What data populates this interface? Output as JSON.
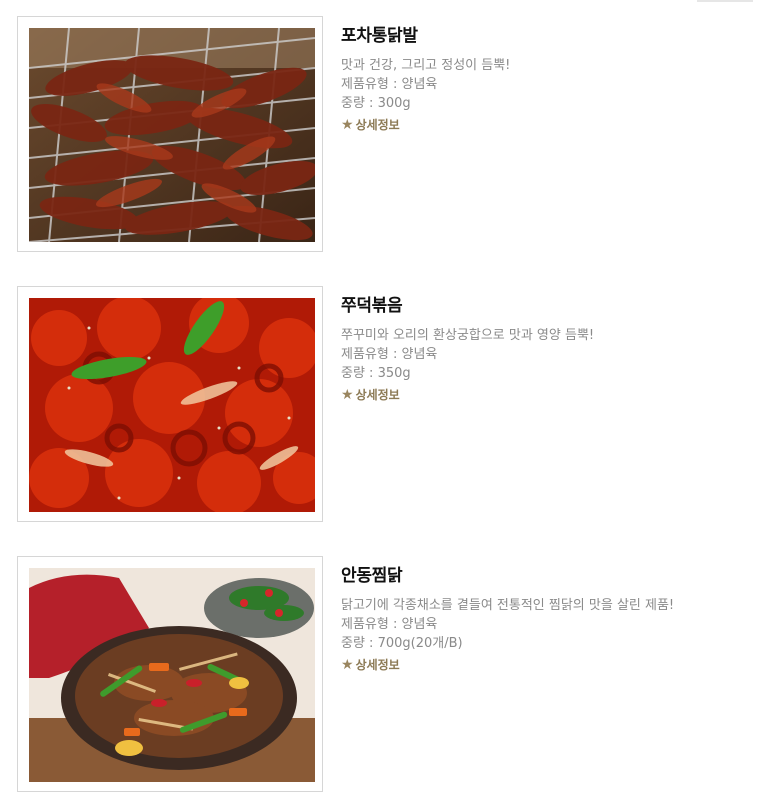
{
  "products": [
    {
      "name": "포차통닭발",
      "tagline": "맛과 건강, 그리고 정성이 듬뿍!",
      "type": "제품유형 : 양념육",
      "weight": "중량 : 300g",
      "detail_label": "상세정보",
      "image": "grilled-chicken-feet-photo"
    },
    {
      "name": "쭈덕볶음",
      "tagline": "쭈꾸미와 오리의 환상궁합으로 맛과 영양 듬뿍!",
      "type": "제품유형 : 양념육",
      "weight": "중량 : 350g",
      "detail_label": "상세정보",
      "image": "spicy-webfoot-octopus-duck-photo"
    },
    {
      "name": "안동찜닭",
      "tagline": "닭고기에 각종채소를 곁들여 전통적인 찜닭의 맛을 살린 제품!",
      "type": "제품유형 : 양념육",
      "weight": "중량 : 700g(20개/B)",
      "detail_label": "상세정보",
      "image": "andong-braised-chicken-photo"
    }
  ],
  "icons": {
    "detail": "star-icon"
  },
  "colors": {
    "title": "#111111",
    "text": "#8a8a8a",
    "detail_link": "#8c7a55",
    "border": "#d6d6d6"
  }
}
